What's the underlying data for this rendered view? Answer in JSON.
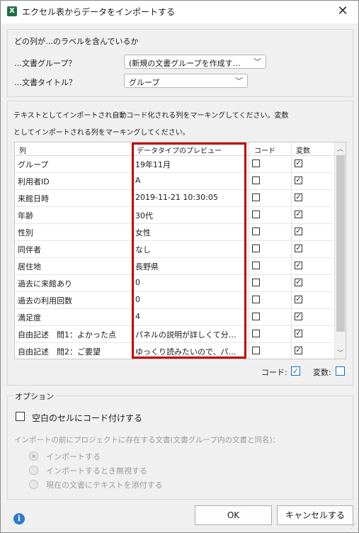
{
  "window": {
    "title": "エクセル表からデータをインポートする",
    "app_icon": "X",
    "close_glyph": "✕"
  },
  "labels_section": {
    "heading": "どの列が…のラベルを含んでいるか",
    "doc_group_label": "…文書グループ？",
    "doc_group_value": "(新規の文書グループを作成す…",
    "doc_title_label": "…文書タイトル？",
    "doc_title_value": "グループ"
  },
  "marking": {
    "instruction_line1": "テキストとしてインポートされ自動コード化される列をマーキングしてください。変数",
    "instruction_line2": "としてインポートされる列をマーキングしてください。",
    "headers": {
      "column": "列",
      "preview": "データタイプのプレビュー",
      "code": "コード",
      "variable": "変数"
    },
    "rows": [
      {
        "name": "グループ",
        "preview": "19年11月",
        "code": false,
        "variable": true
      },
      {
        "name": "利用者ID",
        "preview": "A",
        "code": false,
        "variable": true
      },
      {
        "name": "来館日時",
        "preview": "2019-11-21 10:30:05",
        "code": false,
        "variable": true
      },
      {
        "name": "年齢",
        "preview": "30代",
        "code": false,
        "variable": true
      },
      {
        "name": "性別",
        "preview": "女性",
        "code": false,
        "variable": true
      },
      {
        "name": "同伴者",
        "preview": "なし",
        "code": false,
        "variable": true
      },
      {
        "name": "居住地",
        "preview": "長野県",
        "code": false,
        "variable": true
      },
      {
        "name": "過去に来館あり",
        "preview": "0",
        "code": false,
        "variable": true
      },
      {
        "name": "過去の利用回数",
        "preview": "0",
        "code": false,
        "variable": true
      },
      {
        "name": "満足度",
        "preview": "4",
        "code": false,
        "variable": true
      },
      {
        "name": "自由記述　問1：よかった点",
        "preview": "パネルの説明が詳しくて分…",
        "code": false,
        "variable": true
      },
      {
        "name": "自由記述　問2：ご要望",
        "preview": "ゆっくり読みたいので、パ…",
        "code": false,
        "variable": true
      }
    ],
    "legend_code_label": "コード:",
    "legend_variable_label": "変数:"
  },
  "options": {
    "heading": "オプション",
    "blank_cells_label": "空白のセルにコード付けする",
    "blank_cells_checked": false,
    "preexisting_label": "インポートの前にプロジェクトに存在する文書(文書グループ内の文書と同名)：",
    "radio_import": "インポートする",
    "radio_ignore": "インポートするとき無視する",
    "radio_append": "現在の文書にテキストを添付する",
    "selected_radio": "インポートする"
  },
  "footer": {
    "info_icon": "i",
    "ok_label": "OK",
    "cancel_label": "キャンセルする"
  },
  "colors": {
    "highlight_box": "#c00000",
    "check_accent": "#0d6fc0",
    "info_icon": "#2b79d2"
  }
}
